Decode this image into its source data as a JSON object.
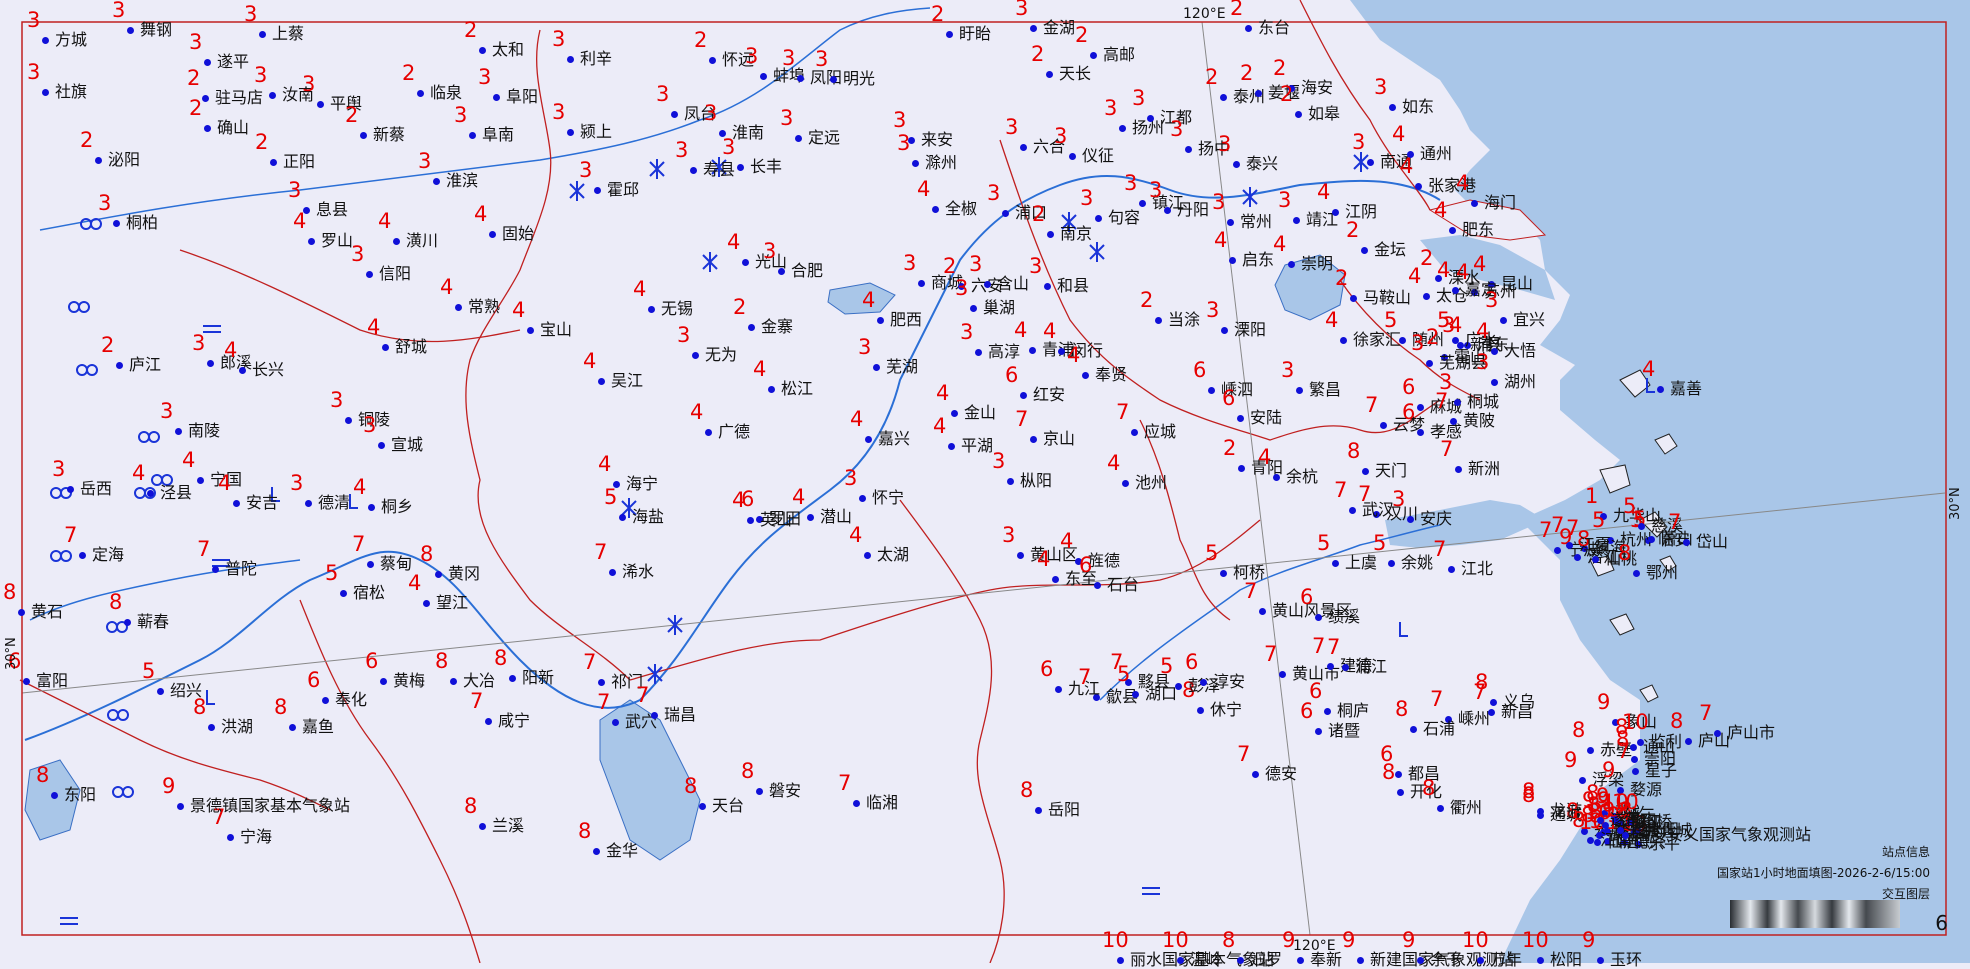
{
  "map": {
    "graticule": {
      "lon_label": "120°E",
      "lat_label": "30°N"
    },
    "colors": {
      "value": "#e60000",
      "station": "#1010d8",
      "boundary": "#c02020",
      "water": "#a9c6e8",
      "land": "#ececf8",
      "river": "#2b6fd6"
    },
    "stations": [
      {
        "name": "方城",
        "value": "3"
      },
      {
        "name": "舞钢",
        "value": "3"
      },
      {
        "name": "上蔡",
        "value": "3"
      },
      {
        "name": "社旗",
        "value": "3"
      },
      {
        "name": "遂平",
        "value": "3"
      },
      {
        "name": "驻马店",
        "value": "2"
      },
      {
        "name": "汝南",
        "value": "3"
      },
      {
        "name": "平舆",
        "value": "3"
      },
      {
        "name": "确山",
        "value": "2"
      },
      {
        "name": "泌阳",
        "value": "2"
      },
      {
        "name": "正阳",
        "value": "2"
      },
      {
        "name": "太和",
        "value": "2"
      },
      {
        "name": "临泉",
        "value": "2"
      },
      {
        "name": "阜阳",
        "value": "3"
      },
      {
        "name": "新蔡",
        "value": "2"
      },
      {
        "name": "阜南",
        "value": "3"
      },
      {
        "name": "颍上",
        "value": "3"
      },
      {
        "name": "利辛",
        "value": "3"
      },
      {
        "name": "怀远",
        "value": "2"
      },
      {
        "name": "蚌埠",
        "value": "3"
      },
      {
        "name": "凤阳",
        "value": "3"
      },
      {
        "name": "明光",
        "value": "3"
      },
      {
        "name": "盱眙",
        "value": "2"
      },
      {
        "name": "金湖",
        "value": "3"
      },
      {
        "name": "天长",
        "value": "2"
      },
      {
        "name": "高邮",
        "value": "2"
      },
      {
        "name": "东台",
        "value": "2"
      },
      {
        "name": "凤台",
        "value": "3"
      },
      {
        "name": "淮南",
        "value": "3"
      },
      {
        "name": "定远",
        "value": "3"
      },
      {
        "name": "来安",
        "value": "3"
      },
      {
        "name": "六合",
        "value": "3"
      },
      {
        "name": "仪征",
        "value": "3"
      },
      {
        "name": "扬州",
        "value": "3"
      },
      {
        "name": "江都",
        "value": "3"
      },
      {
        "name": "泰州",
        "value": "2"
      },
      {
        "name": "姜堰",
        "value": "2"
      },
      {
        "name": "海安",
        "value": "2"
      },
      {
        "name": "如皋",
        "value": "2"
      },
      {
        "name": "如东",
        "value": "3"
      },
      {
        "name": "淮滨",
        "value": "3"
      },
      {
        "name": "寿县",
        "value": "3"
      },
      {
        "name": "长丰",
        "value": "3"
      },
      {
        "name": "霍邱",
        "value": "3"
      },
      {
        "name": "滁州",
        "value": "3"
      },
      {
        "name": "全椒",
        "value": "4"
      },
      {
        "name": "浦口",
        "value": "3"
      },
      {
        "name": "南京",
        "value": "2"
      },
      {
        "name": "句容",
        "value": "3"
      },
      {
        "name": "镇江",
        "value": "3"
      },
      {
        "name": "扬中",
        "value": "3"
      },
      {
        "name": "泰兴",
        "value": "3"
      },
      {
        "name": "南通",
        "value": "3"
      },
      {
        "name": "通州",
        "value": "4"
      },
      {
        "name": "桐柏",
        "value": "3"
      },
      {
        "name": "息县",
        "value": "3"
      },
      {
        "name": "罗山",
        "value": "4"
      },
      {
        "name": "潢川",
        "value": "4"
      },
      {
        "name": "固始",
        "value": "4"
      },
      {
        "name": "丹阳",
        "value": "3"
      },
      {
        "name": "常州",
        "value": "3"
      },
      {
        "name": "靖江",
        "value": "3"
      },
      {
        "name": "江阴",
        "value": "4"
      },
      {
        "name": "张家港",
        "value": "4"
      },
      {
        "name": "海门",
        "value": "4"
      },
      {
        "name": "启东",
        "value": "4"
      },
      {
        "name": "信阳",
        "value": "3"
      },
      {
        "name": "光山",
        "value": "4"
      },
      {
        "name": "合肥",
        "value": "3"
      },
      {
        "name": "肥东",
        "value": "4"
      },
      {
        "name": "金坛",
        "value": "2"
      },
      {
        "name": "崇明",
        "value": "4"
      },
      {
        "name": "常熟",
        "value": "4"
      },
      {
        "name": "无锡",
        "value": "4"
      },
      {
        "name": "商城",
        "value": "3"
      },
      {
        "name": "六安",
        "value": "2"
      },
      {
        "name": "含山",
        "value": "3"
      },
      {
        "name": "和县",
        "value": "3"
      },
      {
        "name": "马鞍山",
        "value": "2"
      },
      {
        "name": "溧水",
        "value": "2"
      },
      {
        "name": "苏州",
        "value": "4"
      },
      {
        "name": "太仓",
        "value": "4"
      },
      {
        "name": "昆山",
        "value": "4"
      },
      {
        "name": "嘉定",
        "value": "4"
      },
      {
        "name": "宝山",
        "value": "4"
      },
      {
        "name": "金寨",
        "value": "2"
      },
      {
        "name": "肥西",
        "value": "4"
      },
      {
        "name": "巢湖",
        "value": "3"
      },
      {
        "name": "当涂",
        "value": "2"
      },
      {
        "name": "溧阳",
        "value": "3"
      },
      {
        "name": "宜兴",
        "value": "3"
      },
      {
        "name": "浦东",
        "value": "4"
      },
      {
        "name": "新县",
        "value": "3"
      },
      {
        "name": "舒城",
        "value": "4"
      },
      {
        "name": "无为",
        "value": "3"
      },
      {
        "name": "芜湖",
        "value": "3"
      },
      {
        "name": "高淳",
        "value": "3"
      },
      {
        "name": "青浦",
        "value": "4"
      },
      {
        "name": "闵行",
        "value": "4"
      },
      {
        "name": "徐家汇",
        "value": "4"
      },
      {
        "name": "随州",
        "value": "5"
      },
      {
        "name": "广水",
        "value": "5"
      },
      {
        "name": "大悟",
        "value": "4"
      },
      {
        "name": "霍山",
        "value": "2"
      },
      {
        "name": "庐江",
        "value": "2"
      },
      {
        "name": "郎溪",
        "value": "3"
      },
      {
        "name": "长兴",
        "value": "4"
      },
      {
        "name": "吴江",
        "value": "4"
      },
      {
        "name": "松江",
        "value": "4"
      },
      {
        "name": "奉贤",
        "value": "4"
      },
      {
        "name": "嵊泗",
        "value": "6"
      },
      {
        "name": "繁昌",
        "value": "3"
      },
      {
        "name": "芜湖县",
        "value": "3"
      },
      {
        "name": "湖州",
        "value": "3"
      },
      {
        "name": "嘉善",
        "value": "4"
      },
      {
        "name": "金山",
        "value": "4"
      },
      {
        "name": "红安",
        "value": "6"
      },
      {
        "name": "安陆",
        "value": "6"
      },
      {
        "name": "麻城",
        "value": "6"
      },
      {
        "name": "桐城",
        "value": "3"
      },
      {
        "name": "铜陵",
        "value": "3"
      },
      {
        "name": "南陵",
        "value": "3"
      },
      {
        "name": "宣城",
        "value": "3"
      },
      {
        "name": "广德",
        "value": "4"
      },
      {
        "name": "嘉兴",
        "value": "4"
      },
      {
        "name": "平湖",
        "value": "4"
      },
      {
        "name": "京山",
        "value": "7"
      },
      {
        "name": "应城",
        "value": "7"
      },
      {
        "name": "云梦",
        "value": "7"
      },
      {
        "name": "孝感",
        "value": "6"
      },
      {
        "name": "黄陂",
        "value": "7"
      },
      {
        "name": "新洲",
        "value": "7"
      },
      {
        "name": "岳西",
        "value": "3"
      },
      {
        "name": "泾县",
        "value": "4"
      },
      {
        "name": "宁国",
        "value": "4"
      },
      {
        "name": "安吉",
        "value": "4"
      },
      {
        "name": "德清",
        "value": "3"
      },
      {
        "name": "桐乡",
        "value": "4"
      },
      {
        "name": "海宁",
        "value": "4"
      },
      {
        "name": "海盐",
        "value": "5"
      },
      {
        "name": "罗田",
        "value": "6"
      },
      {
        "name": "英山",
        "value": "4"
      },
      {
        "name": "潜山",
        "value": "4"
      },
      {
        "name": "怀宁",
        "value": "3"
      },
      {
        "name": "枞阳",
        "value": "3"
      },
      {
        "name": "池州",
        "value": "4"
      },
      {
        "name": "青阳",
        "value": "2"
      },
      {
        "name": "余杭",
        "value": "4"
      },
      {
        "name": "天门",
        "value": "8"
      },
      {
        "name": "汉川",
        "value": "7"
      },
      {
        "name": "武汉",
        "value": "7"
      },
      {
        "name": "安庆",
        "value": "3"
      },
      {
        "name": "九华山",
        "value": "1"
      },
      {
        "name": "临安",
        "value": "3"
      },
      {
        "name": "杭州",
        "value": "5"
      },
      {
        "name": "萧山",
        "value": "5"
      },
      {
        "name": "慈溪",
        "value": "5"
      },
      {
        "name": "岱山",
        "value": "7"
      },
      {
        "name": "定海",
        "value": "7"
      },
      {
        "name": "普陀",
        "value": "7"
      },
      {
        "name": "蔡甸",
        "value": "7"
      },
      {
        "name": "黄冈",
        "value": "8"
      },
      {
        "name": "浠水",
        "value": "7"
      },
      {
        "name": "太湖",
        "value": "4"
      },
      {
        "name": "黄山区",
        "value": "3"
      },
      {
        "name": "旌德",
        "value": "4"
      },
      {
        "name": "柯桥",
        "value": "5"
      },
      {
        "name": "上虞",
        "value": "5"
      },
      {
        "name": "余姚",
        "value": "5"
      },
      {
        "name": "江北",
        "value": "7"
      },
      {
        "name": "镇海",
        "value": "7"
      },
      {
        "name": "宁波",
        "value": "7"
      },
      {
        "name": "潜江",
        "value": "9"
      },
      {
        "name": "仙桃",
        "value": "8"
      },
      {
        "name": "江夏",
        "value": "7"
      },
      {
        "name": "鄂州",
        "value": "8"
      },
      {
        "name": "黄石",
        "value": "8"
      },
      {
        "name": "蕲春",
        "value": "8"
      },
      {
        "name": "宿松",
        "value": "5"
      },
      {
        "name": "望江",
        "value": "4"
      },
      {
        "name": "东至",
        "value": "4"
      },
      {
        "name": "石台",
        "value": "6"
      },
      {
        "name": "黄山风景区",
        "value": "7"
      },
      {
        "name": "绩溪",
        "value": "6"
      },
      {
        "name": "富阳",
        "value": "6"
      },
      {
        "name": "绍兴",
        "value": "5"
      },
      {
        "name": "奉化",
        "value": "6"
      },
      {
        "name": "黄梅",
        "value": "6"
      },
      {
        "name": "大冶",
        "value": "8"
      },
      {
        "name": "阳新",
        "value": "8"
      },
      {
        "name": "祁门",
        "value": "7"
      },
      {
        "name": "黟县",
        "value": "7"
      },
      {
        "name": "歙县",
        "value": "7"
      },
      {
        "name": "休宁",
        "value": "8"
      },
      {
        "name": "黄山市",
        "value": "7"
      },
      {
        "name": "桐庐",
        "value": "6"
      },
      {
        "name": "诸暨",
        "value": "6"
      },
      {
        "name": "嵊州",
        "value": "7"
      },
      {
        "name": "新昌",
        "value": "7"
      },
      {
        "name": "象山",
        "value": "9"
      },
      {
        "name": "监利",
        "value": "10"
      },
      {
        "name": "洪湖",
        "value": "8"
      },
      {
        "name": "嘉鱼",
        "value": "8"
      },
      {
        "name": "咸宁",
        "value": "7"
      },
      {
        "name": "武穴",
        "value": "7"
      },
      {
        "name": "瑞昌",
        "value": "7"
      },
      {
        "name": "九江",
        "value": "6"
      },
      {
        "name": "湖口",
        "value": "5"
      },
      {
        "name": "彭泽",
        "value": "5"
      },
      {
        "name": "淳安",
        "value": "6"
      },
      {
        "name": "建德",
        "value": "7"
      },
      {
        "name": "浦江",
        "value": "7"
      },
      {
        "name": "义乌",
        "value": "8"
      },
      {
        "name": "东阳",
        "value": "8"
      },
      {
        "name": "宁海",
        "value": "7"
      },
      {
        "name": "石浦",
        "value": "8"
      },
      {
        "name": "赤壁",
        "value": "8"
      },
      {
        "name": "崇阳",
        "value": "8"
      },
      {
        "name": "通山",
        "value": "8"
      },
      {
        "name": "星子",
        "value": "7"
      },
      {
        "name": "庐山",
        "value": "8"
      },
      {
        "name": "庐山市",
        "value": "7"
      },
      {
        "name": "浮梁",
        "value": "9"
      },
      {
        "name": "婺源",
        "value": "9"
      },
      {
        "name": "景德镇国家基本气象站",
        "value": "9"
      },
      {
        "name": "兰溪",
        "value": "8"
      },
      {
        "name": "金华",
        "value": "8"
      },
      {
        "name": "磐安",
        "value": "8"
      },
      {
        "name": "天台",
        "value": "8"
      },
      {
        "name": "临湘",
        "value": "7"
      },
      {
        "name": "岳阳",
        "value": "8"
      },
      {
        "name": "德安",
        "value": "7"
      },
      {
        "name": "都昌",
        "value": "6"
      },
      {
        "name": "开化",
        "value": "8"
      },
      {
        "name": "衢州",
        "value": "8"
      },
      {
        "name": "龙游",
        "value": "8"
      },
      {
        "name": "武义",
        "value": "8"
      },
      {
        "name": "永康",
        "value": "8"
      },
      {
        "name": "仙居",
        "value": "10"
      },
      {
        "name": "临海",
        "value": "8"
      },
      {
        "name": "通城",
        "value": "8"
      },
      {
        "name": "武宁",
        "value": "8"
      },
      {
        "name": "共青城",
        "value": "8"
      },
      {
        "name": "鄱阳",
        "value": "8"
      },
      {
        "name": "乐平",
        "value": "10"
      },
      {
        "name": "德兴",
        "value": "10"
      },
      {
        "name": "常山",
        "value": "9"
      },
      {
        "name": "缙云",
        "value": "9"
      },
      {
        "name": "黄岩",
        "value": "10"
      },
      {
        "name": "椒江",
        "value": "10"
      },
      {
        "name": "路桥",
        "value": "10"
      },
      {
        "name": "永修",
        "value": "8"
      },
      {
        "name": "江山",
        "value": "8"
      },
      {
        "name": "修水",
        "value": "9"
      },
      {
        "name": "靖安安义国家气象观测站",
        "value": "9"
      },
      {
        "name": "玉山",
        "value": "9"
      },
      {
        "name": "遂昌",
        "value": "9"
      },
      {
        "name": "丽水国家基本气象站",
        "value": "10"
      },
      {
        "name": "温岭",
        "value": "10"
      },
      {
        "name": "汨罗",
        "value": "8"
      },
      {
        "name": "奉新",
        "value": "9"
      },
      {
        "name": "新建国家气象观测站",
        "value": "9"
      },
      {
        "name": "余干",
        "value": "9"
      },
      {
        "name": "万年",
        "value": "10"
      },
      {
        "name": "松阳",
        "value": "10"
      },
      {
        "name": "玉环",
        "value": "9"
      }
    ],
    "panel": {
      "title": "站点信息",
      "subtitle": "国家站1小时地面填图-2026-2-6/15:00",
      "layer": "交互图层",
      "page": "6"
    }
  }
}
